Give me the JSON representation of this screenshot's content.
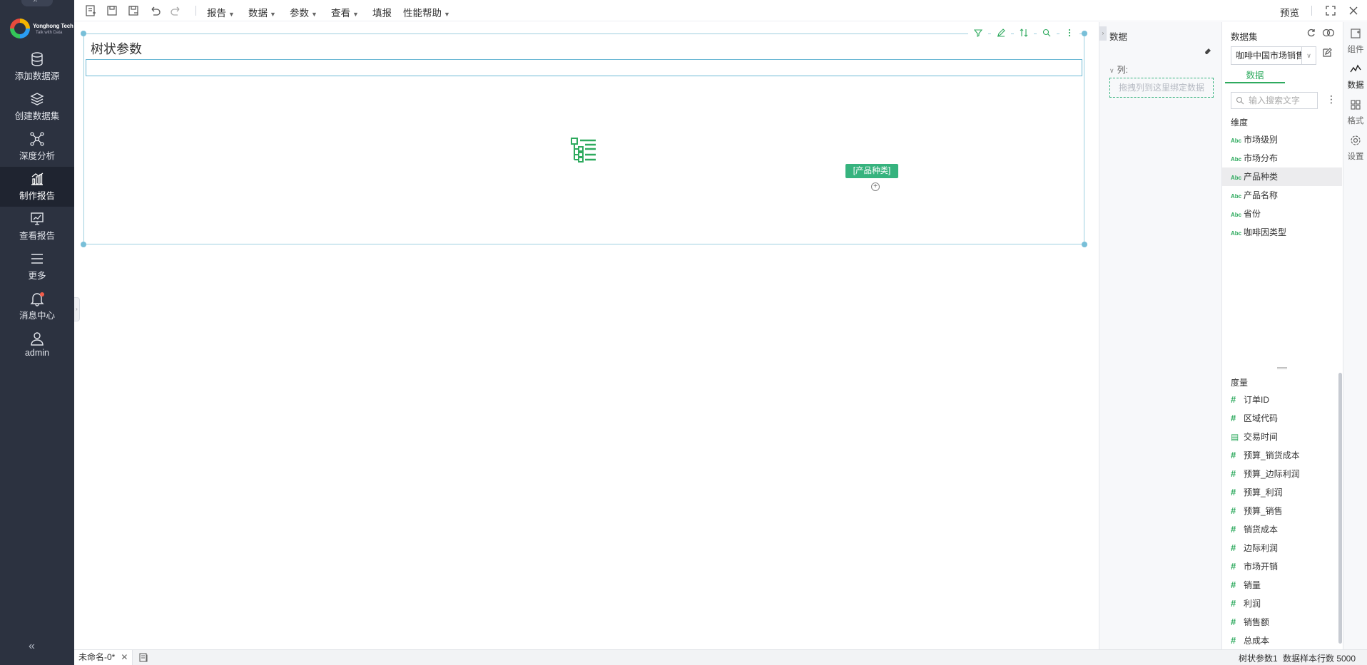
{
  "app": {
    "brand": "Yonghong Tech",
    "tagline": "Talk with Data"
  },
  "leftnav": {
    "items": [
      {
        "label": "添加数据源",
        "icon": "database-icon"
      },
      {
        "label": "创建数据集",
        "icon": "layers-icon"
      },
      {
        "label": "深度分析",
        "icon": "network-icon"
      },
      {
        "label": "制作报告",
        "icon": "chart-icon",
        "active": true
      },
      {
        "label": "查看报告",
        "icon": "monitor-chart-icon"
      },
      {
        "label": "更多",
        "icon": "menu-icon"
      },
      {
        "label": "消息中心",
        "icon": "bell-icon",
        "badge": true
      },
      {
        "label": "admin",
        "icon": "user-icon"
      }
    ]
  },
  "toolbar": {
    "menus": [
      "报告",
      "数据",
      "参数",
      "查看"
    ],
    "fill_label": "填报",
    "help_label": "性能帮助",
    "preview_label": "预览"
  },
  "widget": {
    "title": "树状参数",
    "bound_field_chip": "[产品种类]"
  },
  "bind_panel": {
    "title": "数据",
    "columns_label": "列:",
    "dropzone_text": "拖拽列到这里绑定数据"
  },
  "dataset_panel": {
    "title": "数据集",
    "selected_dataset": "咖啡中国市场销售",
    "tab_label": "数据",
    "search_placeholder": "输入搜索文字",
    "dimensions_label": "维度",
    "dimensions": [
      {
        "name": "市场级别",
        "type": "text"
      },
      {
        "name": "市场分布",
        "type": "text"
      },
      {
        "name": "产品种类",
        "type": "text",
        "highlighted": true
      },
      {
        "name": "产品名称",
        "type": "text"
      },
      {
        "name": "省份",
        "type": "text"
      },
      {
        "name": "咖啡因类型",
        "type": "text"
      }
    ],
    "measures_label": "度量",
    "measures": [
      {
        "name": "订单ID",
        "type": "number"
      },
      {
        "name": "区域代码",
        "type": "number"
      },
      {
        "name": "交易时间",
        "type": "date"
      },
      {
        "name": "预算_销货成本",
        "type": "number"
      },
      {
        "name": "预算_边际利润",
        "type": "number"
      },
      {
        "name": "预算_利润",
        "type": "number"
      },
      {
        "name": "预算_销售",
        "type": "number"
      },
      {
        "name": "销货成本",
        "type": "number"
      },
      {
        "name": "边际利润",
        "type": "number"
      },
      {
        "name": "市场开销",
        "type": "number"
      },
      {
        "name": "销量",
        "type": "number"
      },
      {
        "name": "利润",
        "type": "number"
      },
      {
        "name": "销售额",
        "type": "number"
      },
      {
        "name": "总成本",
        "type": "number"
      }
    ],
    "text_type_badge": "Abc"
  },
  "right_tabs": [
    {
      "label": "组件",
      "icon": "component-icon"
    },
    {
      "label": "数据",
      "icon": "data-icon",
      "active": true
    },
    {
      "label": "格式",
      "icon": "format-icon"
    },
    {
      "label": "设置",
      "icon": "settings-icon"
    }
  ],
  "statusbar": {
    "doc_tab": "未命名-0*",
    "component_name": "树状参数1",
    "sample_rows": "数据样本行数 5000"
  },
  "colors": {
    "accent": "#2eaa5e",
    "sidebar": "#2c3240",
    "selection_border": "#6bb8d4"
  }
}
